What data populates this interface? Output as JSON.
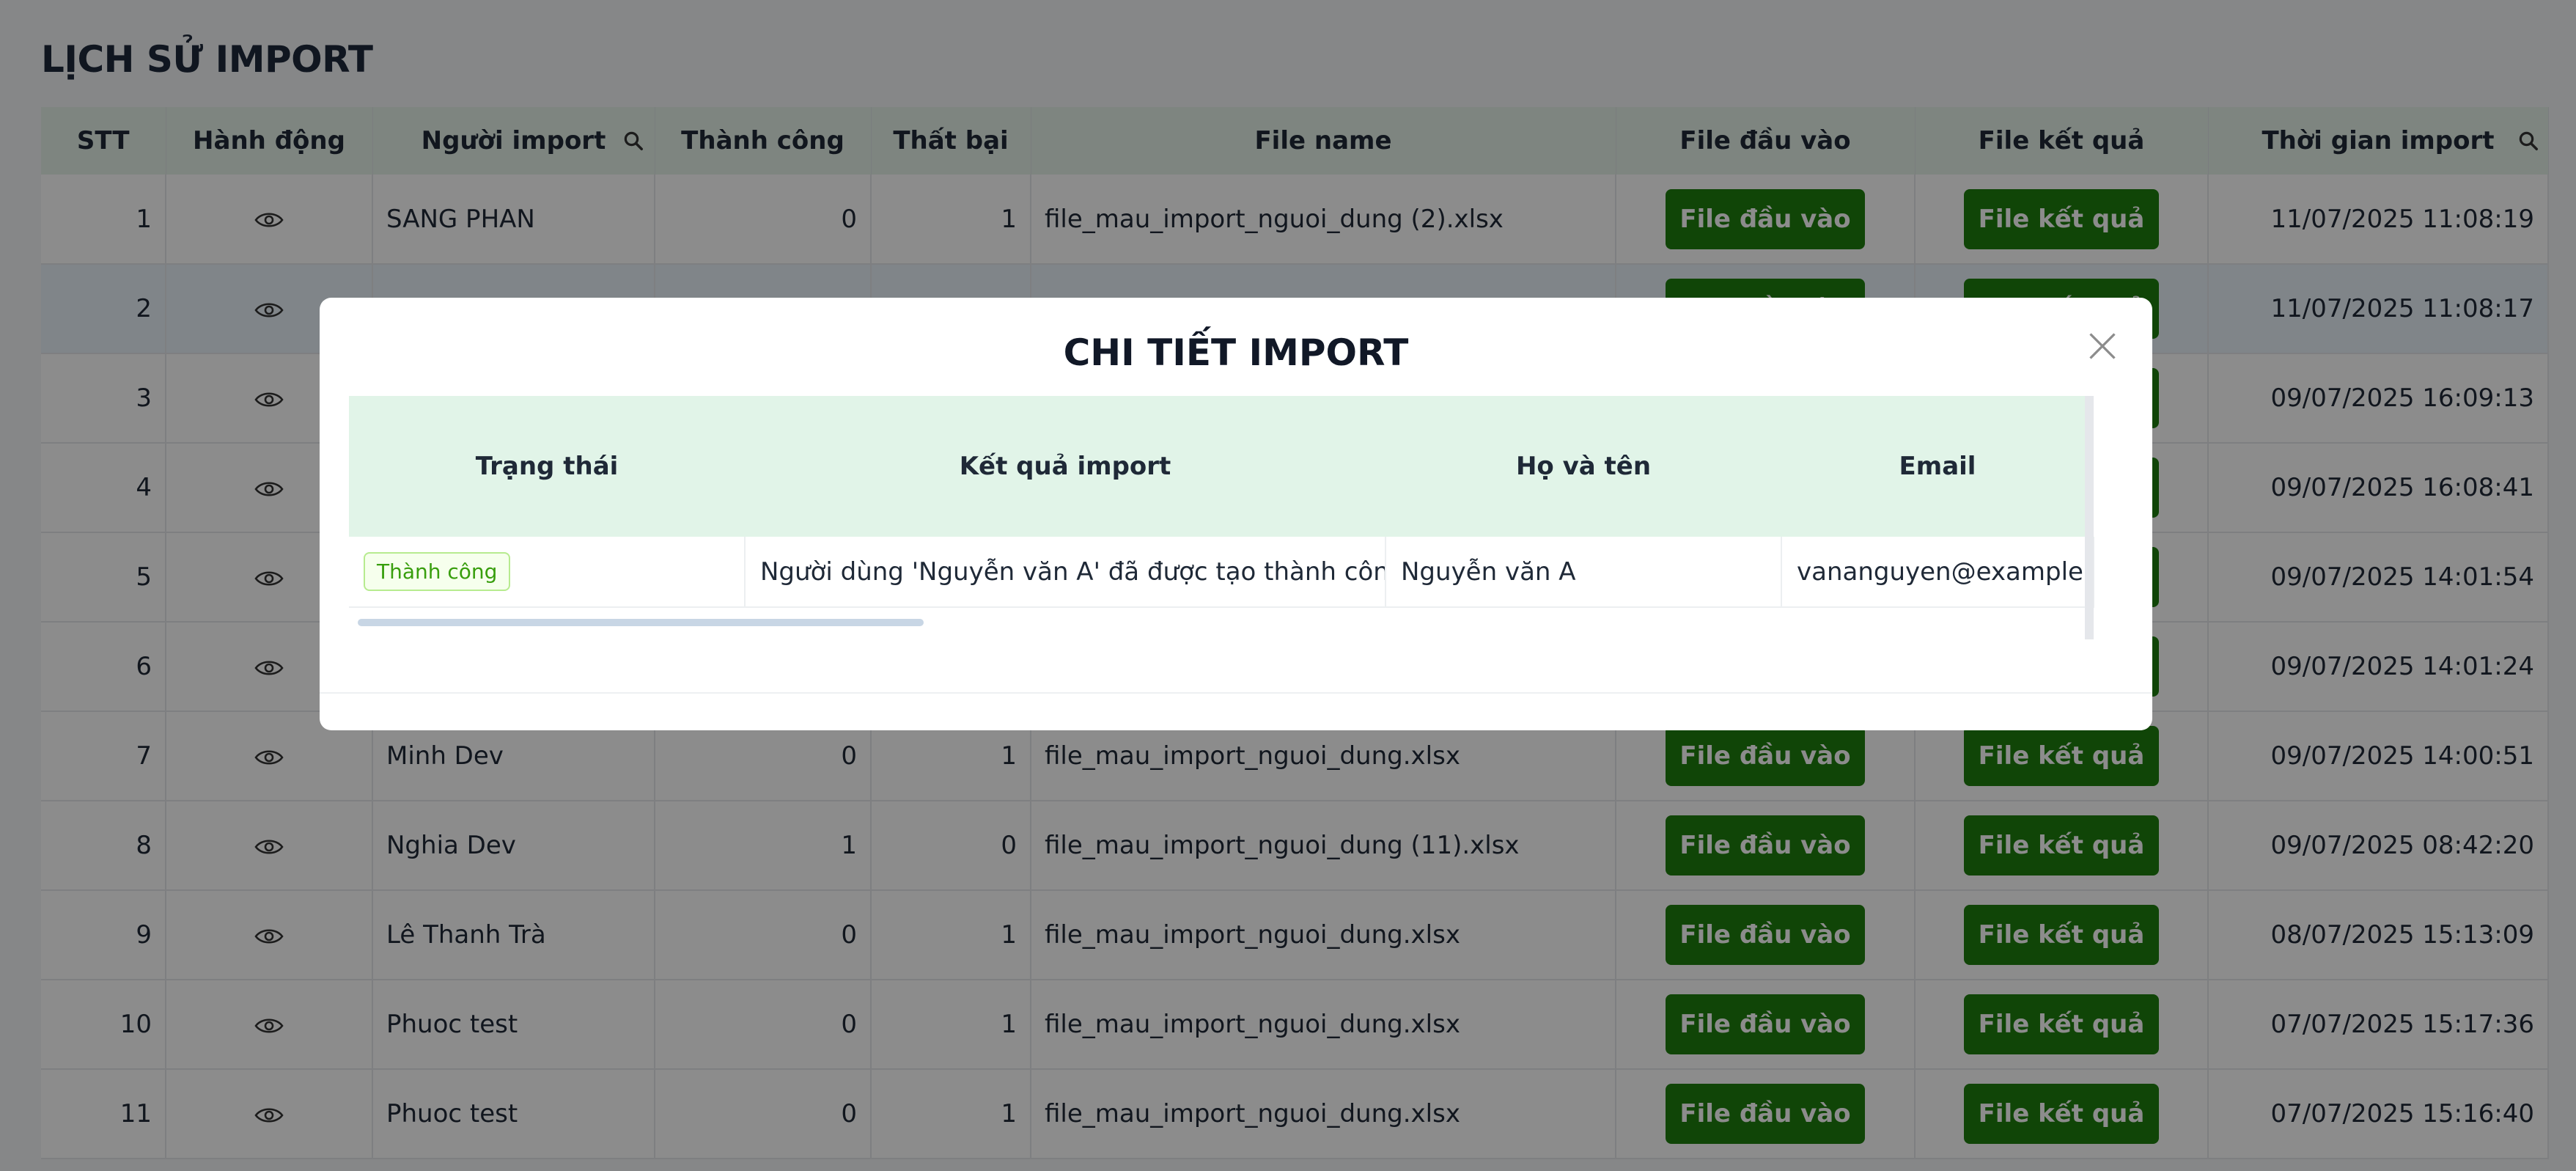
{
  "page": {
    "title": "LỊCH SỬ IMPORT"
  },
  "history_table": {
    "columns": [
      "STT",
      "Hành động",
      "Người import",
      "Thành công",
      "Thất bại",
      "File name",
      "File đầu vào",
      "File kết quả",
      "Thời gian import"
    ],
    "rows": [
      {
        "stt": "1",
        "user": "SANG PHAN",
        "success": "0",
        "failed": "1",
        "file": "file_mau_import_nguoi_dung (2).xlsx",
        "time": "11/07/2025 11:08:19"
      },
      {
        "stt": "2",
        "user": "",
        "success": "",
        "failed": "",
        "file": "",
        "time": "11/07/2025 11:08:17"
      },
      {
        "stt": "3",
        "user": "",
        "success": "",
        "failed": "",
        "file": "",
        "time": "09/07/2025 16:09:13"
      },
      {
        "stt": "4",
        "user": "",
        "success": "",
        "failed": "",
        "file": "",
        "time": "09/07/2025 16:08:41"
      },
      {
        "stt": "5",
        "user": "",
        "success": "",
        "failed": "",
        "file": "",
        "time": "09/07/2025 14:01:54"
      },
      {
        "stt": "6",
        "user": "",
        "success": "",
        "failed": "",
        "file": "",
        "time": "09/07/2025 14:01:24"
      },
      {
        "stt": "7",
        "user": "Minh Dev",
        "success": "0",
        "failed": "1",
        "file": "file_mau_import_nguoi_dung.xlsx",
        "time": "09/07/2025 14:00:51"
      },
      {
        "stt": "8",
        "user": "Nghia Dev",
        "success": "1",
        "failed": "0",
        "file": "file_mau_import_nguoi_dung (11).xlsx",
        "time": "09/07/2025 08:42:20"
      },
      {
        "stt": "9",
        "user": "Lê Thanh Trà",
        "success": "0",
        "failed": "1",
        "file": "file_mau_import_nguoi_dung.xlsx",
        "time": "08/07/2025 15:13:09"
      },
      {
        "stt": "10",
        "user": "Phuoc test",
        "success": "0",
        "failed": "1",
        "file": "file_mau_import_nguoi_dung.xlsx",
        "time": "07/07/2025 15:17:36"
      },
      {
        "stt": "11",
        "user": "Phuoc test",
        "success": "0",
        "failed": "1",
        "file": "file_mau_import_nguoi_dung.xlsx",
        "time": "07/07/2025 15:16:40"
      }
    ],
    "button_input": "File đầu vào",
    "button_result": "File kết quả",
    "action_icon": "eye-icon",
    "search_icon": "search-icon",
    "selected_row": "2"
  },
  "modal": {
    "title": "CHI TIẾT IMPORT",
    "close_icon": "close-icon",
    "columns": [
      "Trạng thái",
      "Kết quả import",
      "Họ và tên",
      "Email"
    ],
    "rows": [
      {
        "status": "Thành công",
        "result": "Người dùng 'Nguyễn văn A' đã được tạo thành công.",
        "name": "Nguyễn văn A",
        "email": "vananguyen@example.com"
      }
    ]
  },
  "colors": {
    "accent_button": "#1e7e0e",
    "header_bg": "#e6f3ea",
    "success_tag": "#389e0d"
  }
}
